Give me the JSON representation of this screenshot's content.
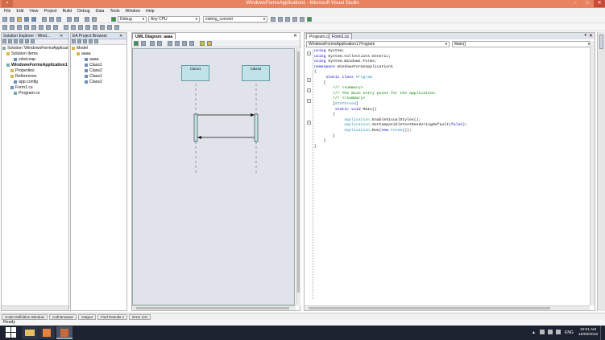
{
  "window": {
    "title": "WindowsFormsApplication1 - Microsoft Visual Studio"
  },
  "menu": [
    "File",
    "Edit",
    "View",
    "Project",
    "Build",
    "Debug",
    "Data",
    "Tools",
    "Window",
    "Help"
  ],
  "toolbar": {
    "config": "Debug",
    "platform": "Any CPU",
    "target": "vstring_convert"
  },
  "solution_explorer": {
    "title": "Solution Explorer - Wind...",
    "items": [
      "Solution 'WindowsFormsApplicat",
      "Solution Items",
      "sdsd.eap",
      "WindowsFormsApplication1",
      "Properties",
      "References",
      "app.config",
      "Form1.cs",
      "Program.cs"
    ]
  },
  "ea_browser": {
    "title": "EA Project Browser",
    "items": [
      "Model",
      "aaaa",
      "aaaa",
      "Class1",
      "Class2",
      "Class1",
      "Class2"
    ]
  },
  "diagram": {
    "tab": "UML Diagram: aaaa",
    "lifelines": [
      "Class1",
      "Class2"
    ]
  },
  "editor": {
    "tabs": [
      "Program.cs",
      "Form1.cs"
    ],
    "class_combo": "WindowsFormsApplication1.Program",
    "member_combo": "Main()",
    "lines": [
      [
        [
          "kw",
          "using"
        ],
        [
          "",
          "System;"
        ]
      ],
      [
        [
          "kw",
          "using"
        ],
        [
          "",
          "System.Collections.Generic;"
        ]
      ],
      [
        [
          "",
          ""
        ]
      ],
      [
        [
          "kw",
          "using"
        ],
        [
          "",
          "System.Windows.Forms;"
        ]
      ],
      [
        [
          "",
          ""
        ]
      ],
      [
        [
          "kw",
          "namespace"
        ],
        [
          "",
          "WindowsFormsApplication1"
        ]
      ],
      [
        [
          "",
          "{"
        ]
      ],
      [
        [
          "",
          "    "
        ],
        [
          "kw",
          "static class"
        ],
        [
          "ty",
          "Program"
        ]
      ],
      [
        [
          "",
          "    {"
        ]
      ],
      [
        [
          "cm",
          "        /// <summary>"
        ]
      ],
      [
        [
          "cm",
          "        /// The main entry point for the application."
        ]
      ],
      [
        [
          "cm",
          "        /// </summary>"
        ]
      ],
      [
        [
          "",
          "        ["
        ],
        [
          "ty",
          "STAThread"
        ],
        [
          "",
          "]"
        ]
      ],
      [
        [
          "",
          "        "
        ],
        [
          "kw",
          "static void"
        ],
        [
          "",
          "Main()"
        ]
      ],
      [
        [
          "",
          "        {"
        ]
      ],
      [
        [
          "",
          "            "
        ],
        [
          "ty",
          "Application"
        ],
        [
          "",
          ".EnableVisualStyles();"
        ]
      ],
      [
        [
          "",
          "            "
        ],
        [
          "ty",
          "Application"
        ],
        [
          "",
          ".SetCompatibleTextRenderingDefault("
        ],
        [
          "kw",
          "false"
        ],
        [
          "",
          ");"
        ]
      ],
      [
        [
          "",
          "            "
        ],
        [
          "ty",
          "Application"
        ],
        [
          "",
          ".Run("
        ],
        [
          "kw",
          "new"
        ],
        [
          "ty",
          "Form1"
        ],
        [
          "",
          "());"
        ]
      ],
      [
        [
          "",
          "        }"
        ]
      ],
      [
        [
          "",
          "    }"
        ]
      ],
      [
        [
          "",
          "}"
        ]
      ]
    ]
  },
  "bottom_tabs": [
    "Code Definition Window",
    "Call Browser",
    "Output",
    "Find Results 1",
    "Error List"
  ],
  "status": "Ready",
  "tray": {
    "lang": "ENG",
    "time": "10:51 AM",
    "date": "18/06/2018"
  }
}
